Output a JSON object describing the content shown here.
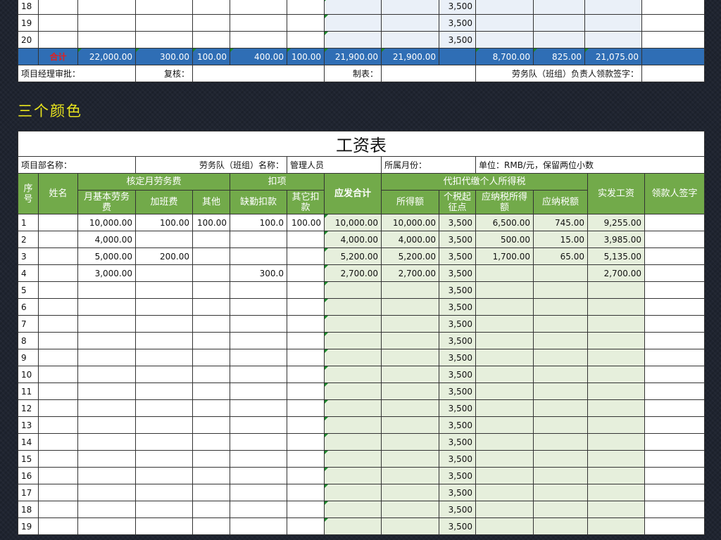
{
  "top_table": {
    "rows": [
      {
        "no": "18",
        "threshold": "3,500"
      },
      {
        "no": "19",
        "threshold": "3,500"
      },
      {
        "no": "20",
        "threshold": "3,500"
      }
    ],
    "total": {
      "label": "合计",
      "base_pay": "22,000.00",
      "overtime": "300.00",
      "other": "100.00",
      "absence": "400.00",
      "other_deduct": "100.00",
      "gross": "21,900.00",
      "taxable": "21,900.00",
      "taxable_income": "8,700.00",
      "tax": "825.00",
      "net": "21,075.00"
    },
    "signatures": {
      "manager": "项目经理审批：",
      "review": "复核：",
      "prepared": "制表：",
      "leader": "劳务队（班组）负责人领款签字："
    }
  },
  "section_heading": "三个颜色",
  "sheet": {
    "title": "工资表",
    "info": {
      "dept_label": "项目部名称：",
      "team_label": "劳务队（班组）名称：",
      "team_value": "管理人员",
      "month_label": "所属月份：",
      "unit_label": "单位：RMB/元，保留两位小数"
    },
    "headers": {
      "no": "序号",
      "name": "姓名",
      "approved": "核定月劳务费",
      "base": "月基本劳务费",
      "overtime": "加班费",
      "other": "其他",
      "deductions": "扣项",
      "absence": "缺勤扣款",
      "other_deduct": "其它扣款",
      "gross": "应发合计",
      "tax_group": "代扣代缴个人所得税",
      "taxable": "所得额",
      "threshold": "个税起征点",
      "taxable_income": "应纳税所得额",
      "tax": "应纳税额",
      "net": "实发工资",
      "sign": "领款人签字"
    },
    "rows": [
      {
        "no": "1",
        "base": "10,000.00",
        "overtime": "100.00",
        "other": "100.00",
        "absence": "100.0",
        "other_deduct": "100.00",
        "gross": "10,000.00",
        "taxable": "10,000.00",
        "threshold": "3,500",
        "taxable_income": "6,500.00",
        "tax": "745.00",
        "net": "9,255.00"
      },
      {
        "no": "2",
        "base": "4,000.00",
        "overtime": "",
        "other": "",
        "absence": "",
        "other_deduct": "",
        "gross": "4,000.00",
        "taxable": "4,000.00",
        "threshold": "3,500",
        "taxable_income": "500.00",
        "tax": "15.00",
        "net": "3,985.00"
      },
      {
        "no": "3",
        "base": "5,000.00",
        "overtime": "200.00",
        "other": "",
        "absence": "",
        "other_deduct": "",
        "gross": "5,200.00",
        "taxable": "5,200.00",
        "threshold": "3,500",
        "taxable_income": "1,700.00",
        "tax": "65.00",
        "net": "5,135.00"
      },
      {
        "no": "4",
        "base": "3,000.00",
        "overtime": "",
        "other": "",
        "absence": "300.0",
        "other_deduct": "",
        "gross": "2,700.00",
        "taxable": "2,700.00",
        "threshold": "3,500",
        "taxable_income": "",
        "tax": "",
        "net": "2,700.00"
      },
      {
        "no": "5",
        "base": "",
        "overtime": "",
        "other": "",
        "absence": "",
        "other_deduct": "",
        "gross": "",
        "taxable": "",
        "threshold": "3,500",
        "taxable_income": "",
        "tax": "",
        "net": ""
      },
      {
        "no": "6",
        "base": "",
        "overtime": "",
        "other": "",
        "absence": "",
        "other_deduct": "",
        "gross": "",
        "taxable": "",
        "threshold": "3,500",
        "taxable_income": "",
        "tax": "",
        "net": ""
      },
      {
        "no": "7",
        "base": "",
        "overtime": "",
        "other": "",
        "absence": "",
        "other_deduct": "",
        "gross": "",
        "taxable": "",
        "threshold": "3,500",
        "taxable_income": "",
        "tax": "",
        "net": ""
      },
      {
        "no": "8",
        "base": "",
        "overtime": "",
        "other": "",
        "absence": "",
        "other_deduct": "",
        "gross": "",
        "taxable": "",
        "threshold": "3,500",
        "taxable_income": "",
        "tax": "",
        "net": ""
      },
      {
        "no": "9",
        "base": "",
        "overtime": "",
        "other": "",
        "absence": "",
        "other_deduct": "",
        "gross": "",
        "taxable": "",
        "threshold": "3,500",
        "taxable_income": "",
        "tax": "",
        "net": ""
      },
      {
        "no": "10",
        "base": "",
        "overtime": "",
        "other": "",
        "absence": "",
        "other_deduct": "",
        "gross": "",
        "taxable": "",
        "threshold": "3,500",
        "taxable_income": "",
        "tax": "",
        "net": ""
      },
      {
        "no": "11",
        "base": "",
        "overtime": "",
        "other": "",
        "absence": "",
        "other_deduct": "",
        "gross": "",
        "taxable": "",
        "threshold": "3,500",
        "taxable_income": "",
        "tax": "",
        "net": ""
      },
      {
        "no": "12",
        "base": "",
        "overtime": "",
        "other": "",
        "absence": "",
        "other_deduct": "",
        "gross": "",
        "taxable": "",
        "threshold": "3,500",
        "taxable_income": "",
        "tax": "",
        "net": ""
      },
      {
        "no": "13",
        "base": "",
        "overtime": "",
        "other": "",
        "absence": "",
        "other_deduct": "",
        "gross": "",
        "taxable": "",
        "threshold": "3,500",
        "taxable_income": "",
        "tax": "",
        "net": ""
      },
      {
        "no": "14",
        "base": "",
        "overtime": "",
        "other": "",
        "absence": "",
        "other_deduct": "",
        "gross": "",
        "taxable": "",
        "threshold": "3,500",
        "taxable_income": "",
        "tax": "",
        "net": ""
      },
      {
        "no": "15",
        "base": "",
        "overtime": "",
        "other": "",
        "absence": "",
        "other_deduct": "",
        "gross": "",
        "taxable": "",
        "threshold": "3,500",
        "taxable_income": "",
        "tax": "",
        "net": ""
      },
      {
        "no": "16",
        "base": "",
        "overtime": "",
        "other": "",
        "absence": "",
        "other_deduct": "",
        "gross": "",
        "taxable": "",
        "threshold": "3,500",
        "taxable_income": "",
        "tax": "",
        "net": ""
      },
      {
        "no": "17",
        "base": "",
        "overtime": "",
        "other": "",
        "absence": "",
        "other_deduct": "",
        "gross": "",
        "taxable": "",
        "threshold": "3,500",
        "taxable_income": "",
        "tax": "",
        "net": ""
      },
      {
        "no": "18",
        "base": "",
        "overtime": "",
        "other": "",
        "absence": "",
        "other_deduct": "",
        "gross": "",
        "taxable": "",
        "threshold": "3,500",
        "taxable_income": "",
        "tax": "",
        "net": ""
      },
      {
        "no": "19",
        "base": "",
        "overtime": "",
        "other": "",
        "absence": "",
        "other_deduct": "",
        "gross": "",
        "taxable": "",
        "threshold": "3,500",
        "taxable_income": "",
        "tax": "",
        "net": ""
      }
    ]
  },
  "colors": {
    "header_green": "#72aa4a",
    "light_green": "#e6efdc",
    "total_blue": "#2f6eb5",
    "light_blue": "#eaf0f8",
    "heading_yellow": "#e8e41e"
  }
}
